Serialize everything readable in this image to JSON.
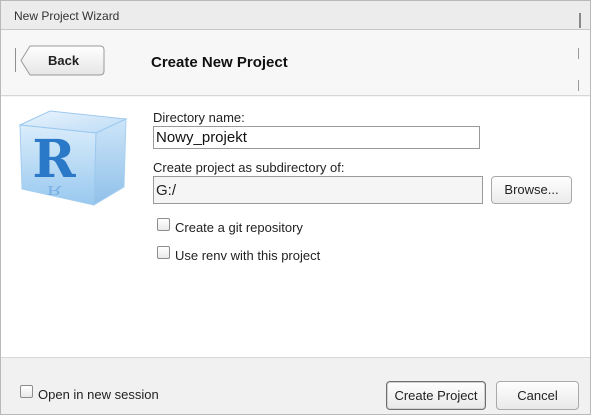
{
  "window": {
    "title": "New Project Wizard"
  },
  "header": {
    "back_label": "Back",
    "page_title": "Create New Project"
  },
  "form": {
    "directory_label": "Directory name:",
    "directory_value": "Nowy_projekt",
    "subdir_label": "Create project as subdirectory of:",
    "subdir_value": "G:/",
    "browse_label": "Browse...",
    "git_label": "Create a git repository",
    "git_checked": false,
    "renv_label": "Use renv with this project",
    "renv_checked": false
  },
  "footer": {
    "new_session_label": "Open in new session",
    "new_session_checked": false,
    "create_label": "Create Project",
    "cancel_label": "Cancel"
  },
  "logo": {
    "letter": "R",
    "icon": "r-logo-cube"
  },
  "colors": {
    "logo_blue": "#2a78c8",
    "window_bg": "#f4f4f4"
  }
}
